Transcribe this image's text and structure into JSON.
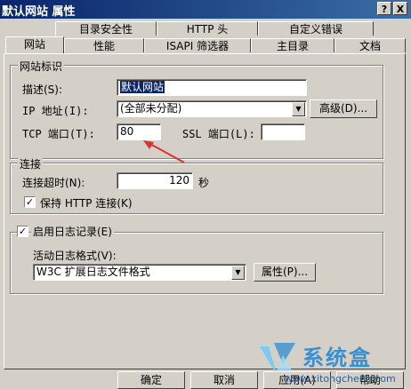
{
  "window": {
    "title": "默认网站 属性",
    "help_btn": "?",
    "close_btn": "X"
  },
  "tabs_back": [
    "目录安全性",
    "HTTP 头",
    "自定义错误"
  ],
  "tabs_front": [
    "网站",
    "性能",
    "ISAPI 筛选器",
    "主目录",
    "文档"
  ],
  "site_group": {
    "legend": "网站标识",
    "desc_label": "描述(S):",
    "desc_value": "默认网站",
    "ip_label": "IP 地址(I):",
    "ip_value": "(全部未分配)",
    "advanced_button": "高级(D)...",
    "tcp_label": "TCP 端口(T):",
    "tcp_value": "80",
    "ssl_label": "SSL 端口(L):",
    "ssl_value": ""
  },
  "conn_group": {
    "legend": "连接",
    "timeout_label": "连接超时(N):",
    "timeout_value": "120",
    "timeout_unit": "秒",
    "keepalive_label": "保持 HTTP 连接(K)",
    "keepalive_checked": true
  },
  "log_group": {
    "legend": "启用日志记录(E)",
    "enabled_checked": true,
    "format_label": "活动日志格式(V):",
    "format_value": "W3C 扩展日志文件格式",
    "properties_button": "属性(P)..."
  },
  "footer": {
    "ok": "确定",
    "cancel": "取消",
    "apply": "应用(A)",
    "help": "帮助"
  },
  "watermark": {
    "text": "系统盒",
    "url": "www.xitongcheng.com"
  },
  "colors": {
    "title": "#0a246a",
    "face": "#d4d0c8",
    "arrow": "#e03030",
    "selection": "#0a246a"
  }
}
